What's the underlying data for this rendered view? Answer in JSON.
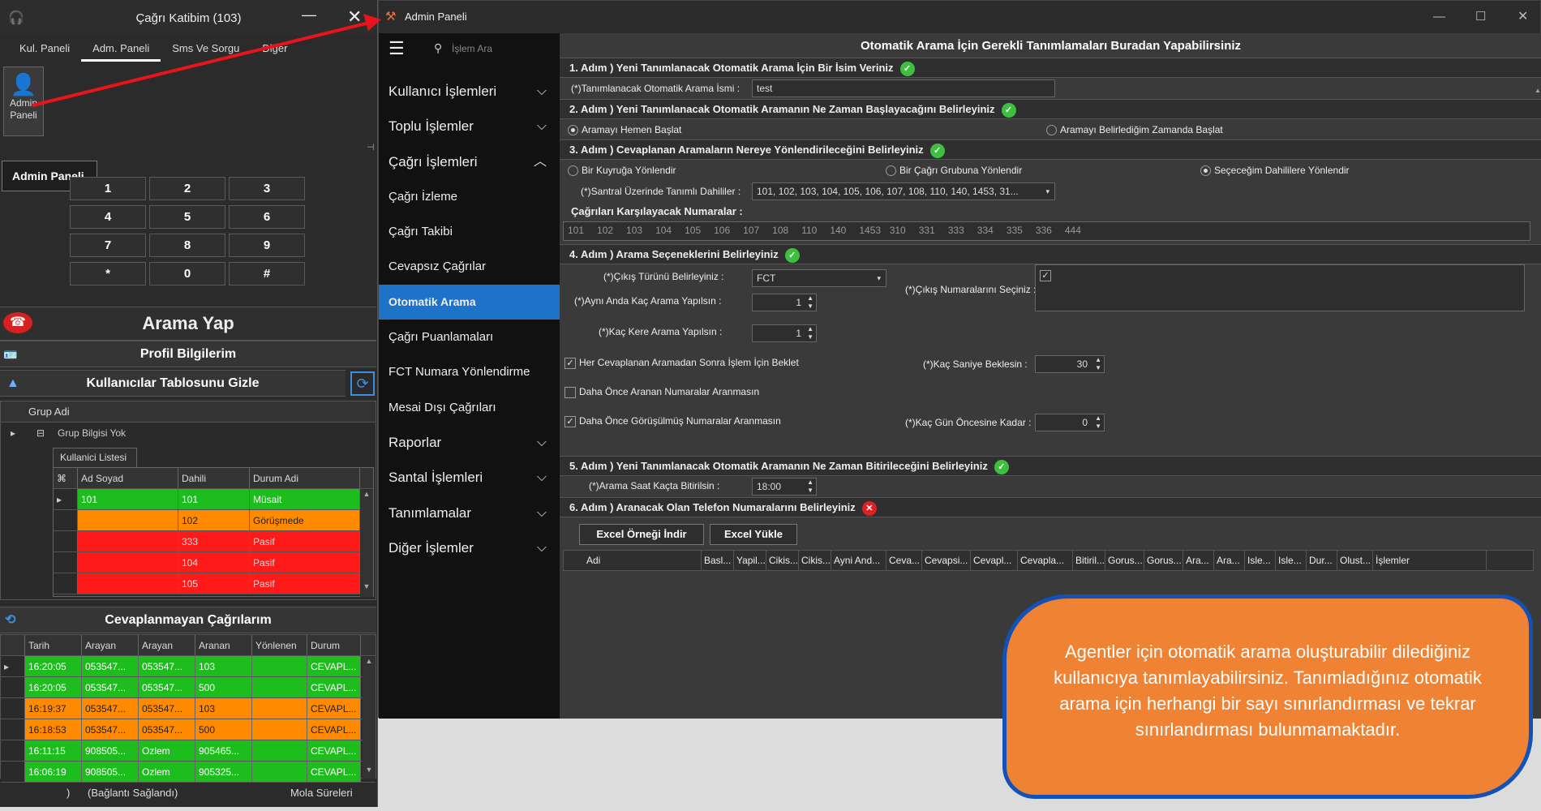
{
  "left_window": {
    "title": "Çağrı Katibim (103)",
    "tabs": [
      "Kul. Paneli",
      "Adm. Paneli",
      "Sms Ve Sorgu",
      "Diğer"
    ],
    "admin_button_label": "Admin Paneli",
    "tooltip": "Admin Paneli",
    "keypad": [
      "1",
      "2",
      "3",
      "4",
      "5",
      "6",
      "7",
      "8",
      "9",
      "*",
      "0",
      "#"
    ],
    "call_button": "Arama Yap",
    "profile_bar": "Profil Bilgilerim",
    "users_bar": "Kullanıcılar Tablosunu Gizle",
    "group_header": "Grup Adi",
    "group_row": "Grup Bilgisi Yok",
    "user_list_tab": "Kullanici Listesi",
    "user_cols": [
      "Ad Soyad",
      "Dahili",
      "Durum Adi"
    ],
    "users": [
      {
        "name": "101",
        "ext": "101",
        "status": "Müsait",
        "color": "g"
      },
      {
        "name": "",
        "ext": "102",
        "status": "Görüşmede",
        "color": "o"
      },
      {
        "name": "",
        "ext": "333",
        "status": "Pasif",
        "color": "r"
      },
      {
        "name": "",
        "ext": "104",
        "status": "Pasif",
        "color": "r"
      },
      {
        "name": "",
        "ext": "105",
        "status": "Pasif",
        "color": "r"
      }
    ],
    "missed_bar": "Cevaplanmayan Çağrılarım",
    "missed_cols": [
      "Tarih",
      "Arayan",
      "Arayan",
      "Aranan",
      "Yönlenen",
      "Durum"
    ],
    "missed": [
      {
        "c": [
          "16:20:05",
          "053547...",
          "053547...",
          "103",
          "",
          "CEVAPL..."
        ],
        "color": "g"
      },
      {
        "c": [
          "16:20:05",
          "053547...",
          "053547...",
          "500",
          "",
          "CEVAPL..."
        ],
        "color": "g"
      },
      {
        "c": [
          "16:19:37",
          "053547...",
          "053547...",
          "103",
          "",
          "CEVAPL..."
        ],
        "color": "o"
      },
      {
        "c": [
          "16:18:53",
          "053547...",
          "053547...",
          "500",
          "",
          "CEVAPL..."
        ],
        "color": "o"
      },
      {
        "c": [
          "16:11:15",
          "908505...",
          "Ozlem",
          "905465...",
          "",
          "CEVAPL..."
        ],
        "color": "g"
      },
      {
        "c": [
          "16:06:19",
          "908505...",
          "Ozlem",
          "905325...",
          "",
          "CEVAPL..."
        ],
        "color": "g"
      }
    ],
    "status_left": ")",
    "status_conn": "(Bağlantı Sağlandı)",
    "status_right": "Mola Süreleri"
  },
  "admin": {
    "title": "Admin Paneli",
    "search_placeholder": "İşlem Ara",
    "menu": [
      {
        "label": "Kullanıcı İşlemleri",
        "chev": "⌵",
        "cls": ""
      },
      {
        "label": "Toplu İşlemler",
        "chev": "⌵",
        "cls": ""
      },
      {
        "label": "Çağrı İşlemleri",
        "chev": "︿",
        "cls": ""
      },
      {
        "label": "Çağrı İzleme",
        "chev": "",
        "cls": "sm"
      },
      {
        "label": "Çağrı Takibi",
        "chev": "",
        "cls": "sm"
      },
      {
        "label": "Cevapsız Çağrılar",
        "chev": "",
        "cls": "sm"
      },
      {
        "label": "Otomatik Arama",
        "chev": "",
        "cls": "sel"
      },
      {
        "label": "Çağrı Puanlamaları",
        "chev": "",
        "cls": "sm"
      },
      {
        "label": "FCT Numara Yönlendirme",
        "chev": "",
        "cls": "sm"
      },
      {
        "label": "Mesai Dışı Çağrıları",
        "chev": "",
        "cls": "sm"
      },
      {
        "label": "Raporlar",
        "chev": "⌵",
        "cls": ""
      },
      {
        "label": "Santal İşlemleri",
        "chev": "⌵",
        "cls": ""
      },
      {
        "label": "Tanımlamalar",
        "chev": "⌵",
        "cls": ""
      },
      {
        "label": "Diğer İşlemler",
        "chev": "⌵",
        "cls": ""
      }
    ],
    "header": "Otomatik Arama İçin Gerekli Tanımlamaları Buradan Yapabilirsiniz",
    "s1": "1. Adım ) Yeni Tanımlanacak Otomatik Arama İçin Bir İsim Veriniz",
    "s1_label": "(*)Tanımlanacak Otomatik Arama İsmi :",
    "s1_value": "test",
    "s2": "2. Adım ) Yeni Tanımlanacak Otomatik Aramanın Ne Zaman Başlayacağını Belirleyiniz",
    "s2_opt1": "Aramayı Hemen Başlat",
    "s2_opt2": "Aramayı Belirlediğim Zamanda Başlat",
    "s3": "3. Adım ) Cevaplanan Aramaların Nereye Yönlendirileceğini Belirleyiniz",
    "s3_opt1": "Bir Kuyruğa Yönlendir",
    "s3_opt2": "Bir Çağrı Grubuna Yönlendir",
    "s3_opt3": "Seçeceğim Dahililere Yönlendir",
    "s3_label": "(*)Santral Üzerinde Tanımlı Dahililer :",
    "s3_value": "101, 102, 103, 104, 105, 106, 107, 108, 110, 140, 1453, 31...",
    "numbers_title": "Çağrıları Karşılayacak Numaralar :",
    "numbers": "101   102   103   104   105   106   107   108   110   140   1453  310   331   333   334   335   336   444",
    "s4": "4. Adım ) Arama Seçeneklerini Belirleyiniz",
    "s4_type_label": "(*)Çıkış Türünü Belirleyiniz :",
    "s4_type_value": "FCT",
    "s4_exit_label": "(*)Çıkış Numaralarını Seçiniz :",
    "s4_same_label": "(*)Aynı Anda Kaç Arama Yapılsın :",
    "s4_same_value": "1",
    "s4_times_label": "(*)Kaç Kere Arama Yapılsın :",
    "s4_times_value": "1",
    "s4_wait": "Her Cevaplanan Aramadan Sonra İşlem İçin Beklet",
    "s4_sec_label": "(*)Kaç Saniye Beklesin :",
    "s4_sec_value": "30",
    "s4_prev": "Daha Önce Aranan Numaralar Aranmasın",
    "s4_talked": "Daha Önce Görüşülmüş Numaralar Aranmasın",
    "s4_days_label": "(*)Kaç Gün Öncesine Kadar :",
    "s4_days_value": "0",
    "s5": "5. Adım ) Yeni Tanımlanacak Otomatik Aramanın Ne Zaman Bitirileceğini Belirleyiniz",
    "s5_label": "(*)Arama Saat Kaçta Bitirilsin :",
    "s5_value": "18:00",
    "s6": "6. Adım ) Aranacak Olan Telefon Numaralarını Belirleyiniz",
    "btn_sample": "Excel Örneği İndir",
    "btn_upload": "Excel Yükle",
    "cols": [
      "Adi",
      "Basl...",
      "Yapil...",
      "Cikis...",
      "Cikis...",
      "Ayni And...",
      "Ceva...",
      "Cevapsi...",
      "Cevapl...",
      "Cevapla...",
      "Bitiril...",
      "Gorus...",
      "Gorus...",
      "Ara...",
      "Ara...",
      "Isle...",
      "Isle...",
      "Dur...",
      "Olust...",
      "İşlemler"
    ]
  },
  "annotation": "Agentler için otomatik arama oluşturabilir dilediğiniz kullanıcıya tanımlayabilirsiniz. Tanımladığınız otomatik arama için herhangi bir sayı sınırlandırması ve tekrar sınırlandırması bulunmamaktadır.",
  "colors": {
    "accent": "#1e73c8",
    "red_arrow": "#e8141b",
    "annotation_bg": "#f08234",
    "annotation_border": "#1251b8"
  }
}
